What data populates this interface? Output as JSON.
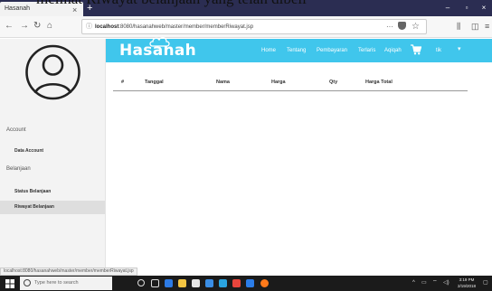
{
  "caption": "melihat Riwayat belanjaan yang telah dibeli",
  "browser": {
    "tab_title": "Hasanah",
    "tab_close": "×",
    "new_tab": "+",
    "win_min": "–",
    "win_max": "▫",
    "win_close": "×",
    "url_host": "localhost",
    "url_path": ":8080/hasanahweb/master/member/memberRiwayat.jsp",
    "page_actions": "···"
  },
  "sidebar": {
    "account_heading": "Account",
    "account_items": [
      {
        "label": "Data Account"
      }
    ],
    "belanjaan_heading": "Belanjaan",
    "belanjaan_items": [
      {
        "label": "Status Belanjaan"
      },
      {
        "label": "Riwayat Belanjaan"
      }
    ]
  },
  "brand": {
    "logo_text": "Hasanah"
  },
  "menu": {
    "items": [
      "Home",
      "Tentang",
      "Pembayaran",
      "Terlaris",
      "Aqiqah"
    ],
    "user": "tik"
  },
  "table": {
    "headers": [
      "#",
      "Tanggal",
      "Nama",
      "Harga",
      "Qty",
      "Harga Total"
    ],
    "rows": []
  },
  "status_url": "localhost:8080/hasanahweb/master/member/memberRiwayat.jsp",
  "taskbar": {
    "search_placeholder": "Type here to search",
    "time": "3:19 PM",
    "date": "2/19/2018"
  },
  "colors": {
    "brand_bar": "#40c6ec",
    "tab_bar": "#2b2d52",
    "sidebar_bg": "#f3f3f3",
    "taskbar": "#1b1b1b"
  }
}
